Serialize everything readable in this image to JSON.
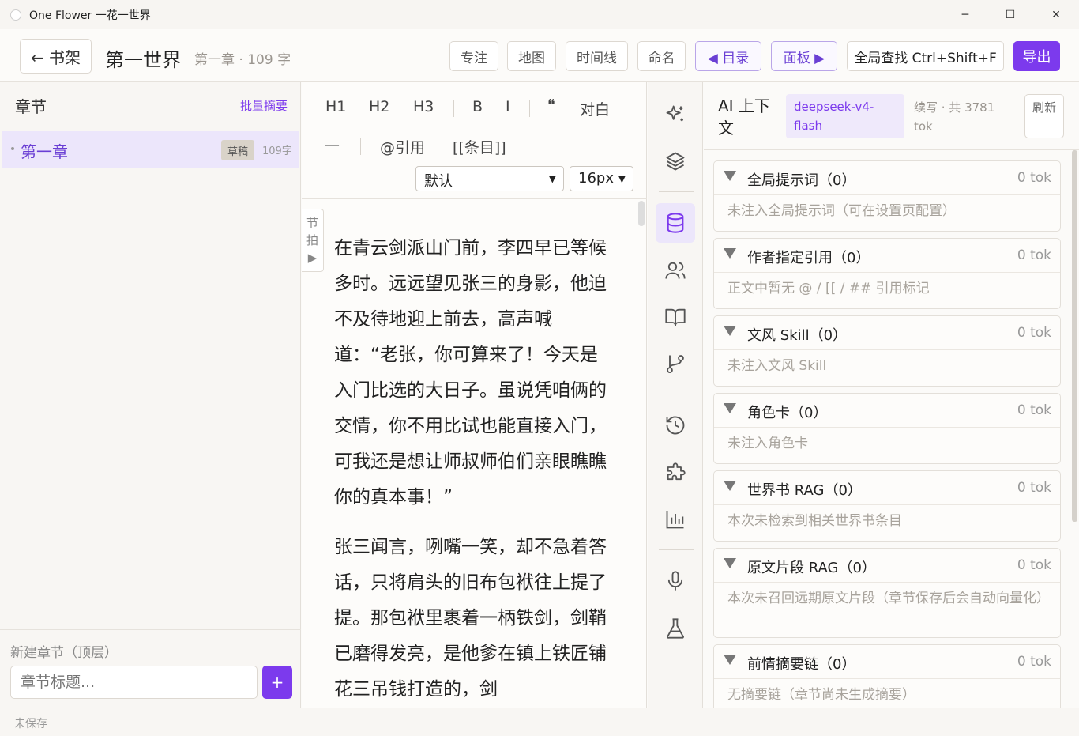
{
  "window": {
    "title": "One Flower 一花一世界",
    "minimize": "─",
    "maximize": "☐",
    "close": "✕"
  },
  "header": {
    "back_label": "← 书架",
    "book_title": "第一世界",
    "book_meta": "第一章 · 109 字",
    "focus": "专注",
    "map": "地图",
    "timeline": "时间线",
    "naming": "命名",
    "toc": "◀ 目录",
    "panel": "面板 ▶",
    "global_search": "全局查找 Ctrl+Shift+F",
    "export": "导出"
  },
  "sidebar": {
    "title": "章节",
    "batch_summary": "批量摘要",
    "chapters": [
      {
        "name": "第一章",
        "badge": "草稿",
        "count": "109字"
      }
    ],
    "new_chapter_label": "新建章节（顶层）",
    "new_chapter_placeholder": "章节标题...",
    "add": "+"
  },
  "editor": {
    "toolbar": {
      "h1": "H1",
      "h2": "H2",
      "h3": "H3",
      "bold": "B",
      "italic": "I",
      "quote": "❝",
      "dialogue": "对白",
      "hr": "—",
      "cite": "@引用",
      "entry": "[[条目]]",
      "font": "默认",
      "size": "16px"
    },
    "beat_label_1": "节",
    "beat_label_2": "拍",
    "beat_arrow": "▶",
    "paragraphs": [
      "在青云剑派山门前，李四早已等候多时。远远望见张三的身影，他迫不及待地迎上前去，高声喊道：“老张，你可算来了！今天是入门比选的大日子。虽说凭咱俩的交情，你不用比试也能直接入门，可我还是想让师叔师伯们亲眼瞧瞧你的真本事！”",
      "张三闻言，咧嘴一笑，却不急着答话，只将肩头的旧布包袱往上提了提。那包袱里裹着一柄铁剑，剑鞘已磨得发亮，是他爹在镇上铁匠铺花三吊钱打造的，剑"
    ]
  },
  "rail": {
    "icons": [
      "sparkles-icon",
      "layers-icon",
      "database-icon",
      "users-icon",
      "book-open-icon",
      "git-branch-icon",
      "history-icon",
      "puzzle-icon",
      "bar-chart-icon",
      "mic-icon",
      "flask-icon"
    ]
  },
  "ai_panel": {
    "title": "AI 上下文",
    "model": "deepseek-v4-flash",
    "usage": "续写 · 共 3781 tok",
    "refresh": "刷新",
    "sections": [
      {
        "name": "全局提示词（0）",
        "tok": "0 tok",
        "body": "未注入全局提示词（可在设置页配置）"
      },
      {
        "name": "作者指定引用（0）",
        "tok": "0 tok",
        "body": "正文中暂无 @ / [[ / ## 引用标记"
      },
      {
        "name": "文风 Skill（0）",
        "tok": "0 tok",
        "body": "未注入文风 Skill"
      },
      {
        "name": "角色卡（0）",
        "tok": "0 tok",
        "body": "未注入角色卡"
      },
      {
        "name": "世界书 RAG（0）",
        "tok": "0 tok",
        "body": "本次未检索到相关世界书条目"
      },
      {
        "name": "原文片段 RAG（0）",
        "tok": "0 tok",
        "body": "本次未召回远期原文片段（章节保存后会自动向量化）"
      },
      {
        "name": "前情摘要链（0）",
        "tok": "0 tok",
        "body": "无摘要链（章节尚未生成摘要）"
      }
    ]
  },
  "status": {
    "text": "未保存"
  },
  "colors": {
    "accent": "#7c3aed",
    "accent_light": "#ece6fb"
  }
}
